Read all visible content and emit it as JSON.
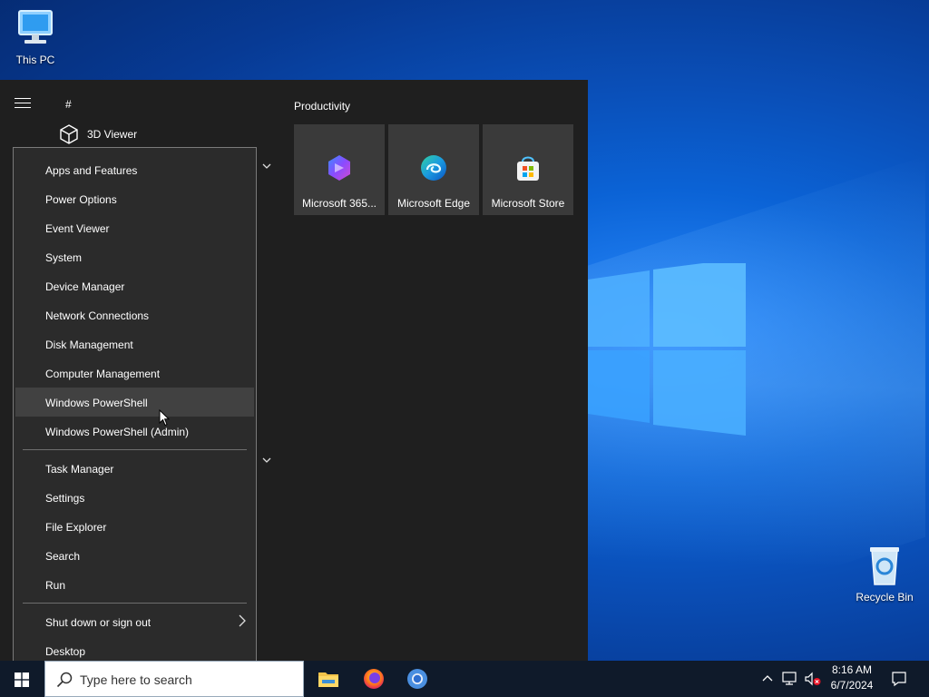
{
  "desktop": {
    "icons": [
      {
        "label": "This PC",
        "icon": "computer-icon"
      },
      {
        "label": "Recycle Bin",
        "icon": "recycle-bin-icon"
      }
    ]
  },
  "start_menu": {
    "section_letter": "#",
    "apps": [
      {
        "label": "3D Viewer",
        "icon": "cube-icon"
      }
    ],
    "productivity": {
      "title": "Productivity",
      "tiles": [
        {
          "label": "Microsoft 365...",
          "icon": "microsoft-365-icon"
        },
        {
          "label": "Microsoft Edge",
          "icon": "edge-icon"
        },
        {
          "label": "Microsoft Store",
          "icon": "store-icon"
        }
      ]
    }
  },
  "context_menu": {
    "group1": [
      "Apps and Features",
      "Power Options",
      "Event Viewer",
      "System",
      "Device Manager",
      "Network Connections",
      "Disk Management",
      "Computer Management",
      "Windows PowerShell",
      "Windows PowerShell (Admin)"
    ],
    "highlighted": "Windows PowerShell",
    "group2": [
      "Task Manager",
      "Settings",
      "File Explorer",
      "Search",
      "Run"
    ],
    "group3": [
      "Shut down or sign out",
      "Desktop"
    ]
  },
  "taskbar": {
    "search_placeholder": "Type here to search",
    "pinned": [
      "file-explorer-icon",
      "firefox-icon",
      "chrome-icon"
    ],
    "clock_time": "8:16 AM",
    "clock_date": "6/7/2024"
  },
  "colors": {
    "start_bg": "#1f1f1f",
    "menu_bg": "#2b2b2b",
    "highlight": "#414141",
    "taskbar_bg": "#0f1a2a"
  }
}
